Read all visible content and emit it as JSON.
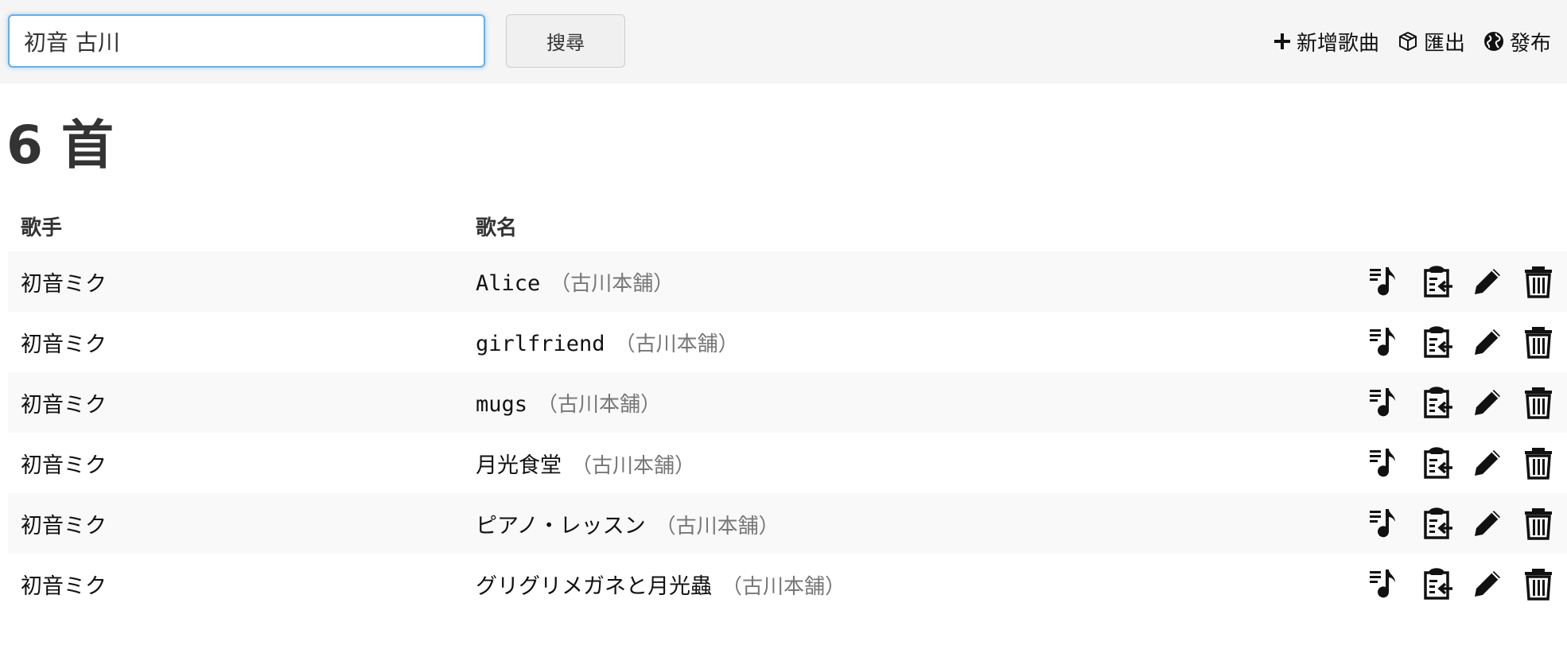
{
  "search": {
    "value": "初音 古川",
    "button_label": "搜尋"
  },
  "toolbar": {
    "add_song": "新增歌曲",
    "export": "匯出",
    "publish": "發布"
  },
  "summary": {
    "count_text": "6 首"
  },
  "table": {
    "headers": {
      "artist": "歌手",
      "title": "歌名"
    },
    "rows": [
      {
        "artist": "初音ミク",
        "title": "Alice",
        "album": "（古川本舗）"
      },
      {
        "artist": "初音ミク",
        "title": "girlfriend",
        "album": "（古川本舗）"
      },
      {
        "artist": "初音ミク",
        "title": "mugs",
        "album": "（古川本舗）"
      },
      {
        "artist": "初音ミク",
        "title": "月光食堂",
        "album": "（古川本舗）"
      },
      {
        "artist": "初音ミク",
        "title": "ピアノ・レッスン",
        "album": "（古川本舗）"
      },
      {
        "artist": "初音ミク",
        "title": "グリグリメガネと月光蟲",
        "album": "（古川本舗）"
      }
    ],
    "row_action_icons": [
      "playlist-music-icon",
      "clipboard-import-icon",
      "pencil-icon",
      "trash-icon"
    ]
  },
  "colors": {
    "topbar_bg": "#f5f5f5",
    "focus_border": "#66afe9",
    "album_text": "#777777",
    "striped_row": "#f9f9f9"
  }
}
